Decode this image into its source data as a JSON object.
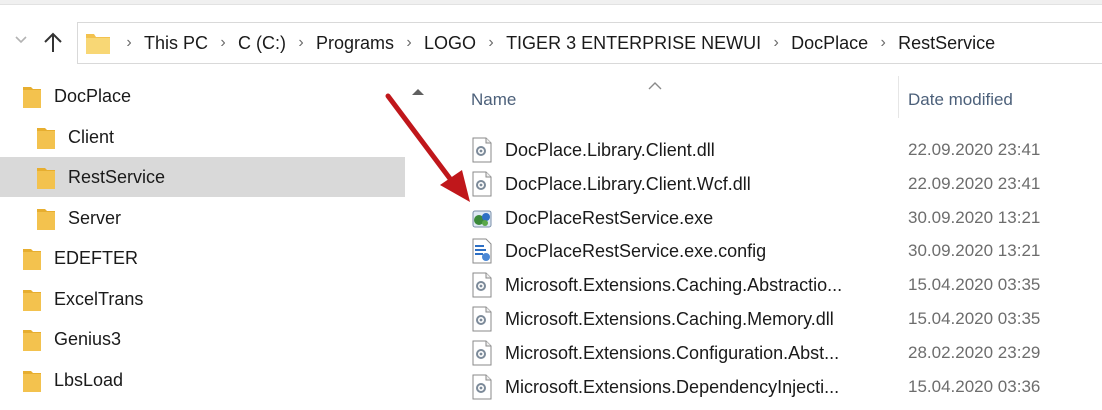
{
  "breadcrumbs": [
    "This PC",
    "C (C:)",
    "Programs",
    "LOGO",
    "TIGER 3 ENTERPRISE NEWUI",
    "DocPlace",
    "RestService"
  ],
  "tree": [
    {
      "label": "DocPlace",
      "level": 0,
      "selected": false
    },
    {
      "label": "Client",
      "level": 1,
      "selected": false
    },
    {
      "label": "RestService",
      "level": 1,
      "selected": true
    },
    {
      "label": "Server",
      "level": 1,
      "selected": false
    },
    {
      "label": "EDEFTER",
      "level": 0,
      "selected": false
    },
    {
      "label": "ExcelTrans",
      "level": 0,
      "selected": false
    },
    {
      "label": "Genius3",
      "level": 0,
      "selected": false
    },
    {
      "label": "LbsLoad",
      "level": 0,
      "selected": false
    }
  ],
  "columns": {
    "name": "Name",
    "date_modified": "Date modified"
  },
  "files": [
    {
      "name": "DocPlace.Library.Client.dll",
      "date": "22.09.2020 23:41",
      "icon": "dll-icon"
    },
    {
      "name": "DocPlace.Library.Client.Wcf.dll",
      "date": "22.09.2020 23:41",
      "icon": "dll-icon"
    },
    {
      "name": "DocPlaceRestService.exe",
      "date": "30.09.2020 13:21",
      "icon": "exe-icon"
    },
    {
      "name": "DocPlaceRestService.exe.config",
      "date": "30.09.2020 13:21",
      "icon": "config-icon"
    },
    {
      "name": "Microsoft.Extensions.Caching.Abstractio...",
      "date": "15.04.2020 03:35",
      "icon": "dll-icon"
    },
    {
      "name": "Microsoft.Extensions.Caching.Memory.dll",
      "date": "15.04.2020 03:35",
      "icon": "dll-icon"
    },
    {
      "name": "Microsoft.Extensions.Configuration.Abst...",
      "date": "28.02.2020 23:29",
      "icon": "dll-icon"
    },
    {
      "name": "Microsoft.Extensions.DependencyInjecti...",
      "date": "15.04.2020 03:36",
      "icon": "dll-icon"
    }
  ],
  "colors": {
    "folder": "#f3c24e",
    "selection": "#d9d9d9",
    "header_text": "#4c607a",
    "annotation_arrow": "#c0171b"
  }
}
